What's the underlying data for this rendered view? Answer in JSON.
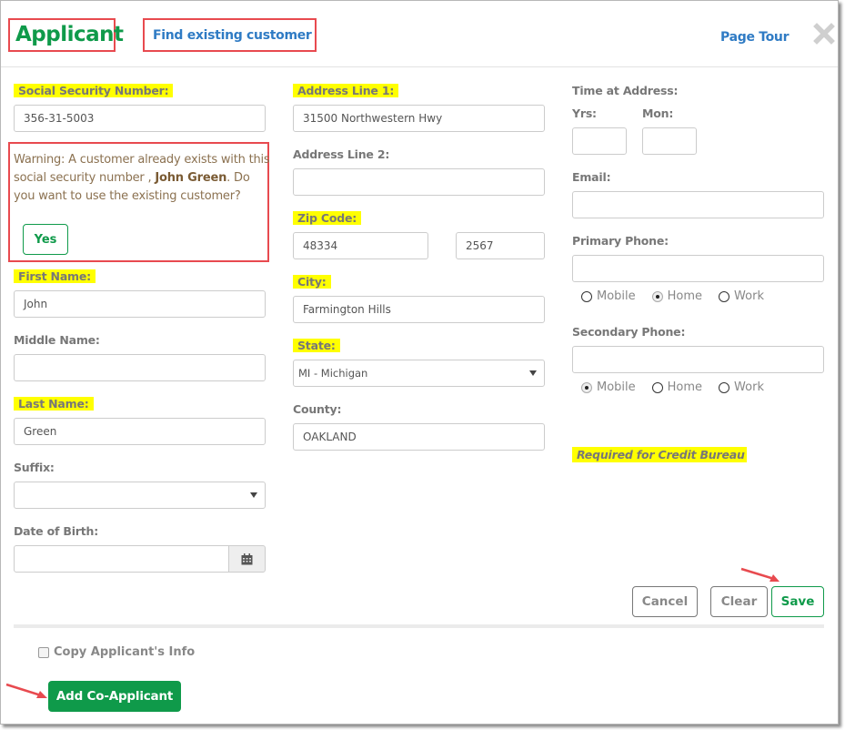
{
  "header": {
    "title": "Applicant",
    "find_link": "Find existing customer",
    "page_tour": "Page Tour",
    "close_icon": "close-x-icon"
  },
  "left": {
    "ssn": {
      "label": "Social Security Number:",
      "value": "356-31-5003",
      "required": true
    },
    "warning": {
      "text_before": "Warning: A customer already exists with this social security number , ",
      "name": "John Green",
      "text_after": ". Do you want to use the existing customer?",
      "yes_label": "Yes"
    },
    "first_name": {
      "label": "First Name:",
      "value": "John",
      "required": true
    },
    "middle_name": {
      "label": "Middle Name:",
      "value": "",
      "required": false
    },
    "last_name": {
      "label": "Last Name:",
      "value": "Green",
      "required": true
    },
    "suffix": {
      "label": "Suffix:",
      "value": "",
      "required": false
    },
    "dob": {
      "label": "Date of Birth:",
      "value": "",
      "icon": "calendar-icon"
    }
  },
  "middle": {
    "address1": {
      "label": "Address Line 1:",
      "value": "31500 Northwestern Hwy",
      "required": true
    },
    "address2": {
      "label": "Address Line 2:",
      "value": "",
      "required": false
    },
    "zip": {
      "label": "Zip Code:",
      "value": "48334",
      "ext": "2567",
      "required": true
    },
    "city": {
      "label": "City:",
      "value": "Farmington Hills",
      "required": true
    },
    "state": {
      "label": "State:",
      "value": "MI - Michigan",
      "required": true
    },
    "county": {
      "label": "County:",
      "value": "OAKLAND",
      "required": false
    }
  },
  "right": {
    "time_at_address": {
      "label": "Time at Address:",
      "yrs_label": "Yrs:",
      "mon_label": "Mon:",
      "yrs": "",
      "mon": ""
    },
    "email": {
      "label": "Email:",
      "value": ""
    },
    "primary_phone": {
      "label": "Primary Phone:",
      "value": "",
      "options": [
        "Mobile",
        "Home",
        "Work"
      ],
      "selected": "Home"
    },
    "secondary_phone": {
      "label": "Secondary Phone:",
      "value": "",
      "options": [
        "Mobile",
        "Home",
        "Work"
      ],
      "selected": "Mobile"
    },
    "required_note": "Required for Credit Bureau"
  },
  "actions": {
    "cancel": "Cancel",
    "clear": "Clear",
    "save": "Save"
  },
  "footer": {
    "copy_label": "Copy Applicant's Info",
    "copy_checked": false,
    "add_co_applicant": "Add Co-Applicant"
  },
  "colors": {
    "brand_green": "#0f9a4a",
    "link_blue": "#2f7bc4",
    "highlight_red": "#e84a4f",
    "required_yellow": "#ffff00"
  }
}
